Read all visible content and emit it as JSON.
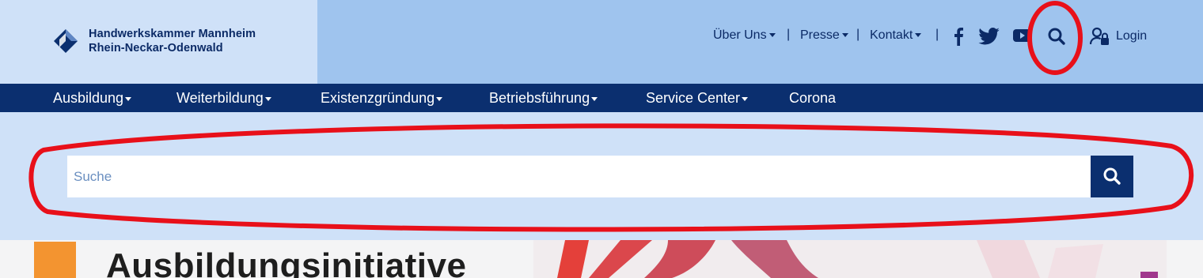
{
  "header": {
    "logo_line1": "Handwerkskammer Mannheim",
    "logo_line2": "Rhein-Neckar-Odenwald",
    "links": [
      {
        "label": "Über Uns"
      },
      {
        "label": "Presse"
      },
      {
        "label": "Kontakt"
      }
    ],
    "separator": "|",
    "social_icons": [
      "facebook-icon",
      "twitter-icon",
      "youtube-icon"
    ],
    "search_icon": "search-icon",
    "login_label": "Login"
  },
  "main_nav": {
    "items": [
      {
        "label": "Ausbildung"
      },
      {
        "label": "Weiterbildung"
      },
      {
        "label": "Existenzgründung"
      },
      {
        "label": "Betriebsführung"
      },
      {
        "label": "Service Center"
      },
      {
        "label": "Corona"
      }
    ]
  },
  "search": {
    "placeholder": "Suche",
    "value": ""
  },
  "content": {
    "headline": "Ausbildungsinitiative"
  },
  "colors": {
    "header_bg": "#9fc4ee",
    "logo_panel_bg": "#cfe1f8",
    "nav_bg": "#0b2f6f",
    "accent_orange": "#f39430",
    "annotation_red": "#e8101a"
  }
}
